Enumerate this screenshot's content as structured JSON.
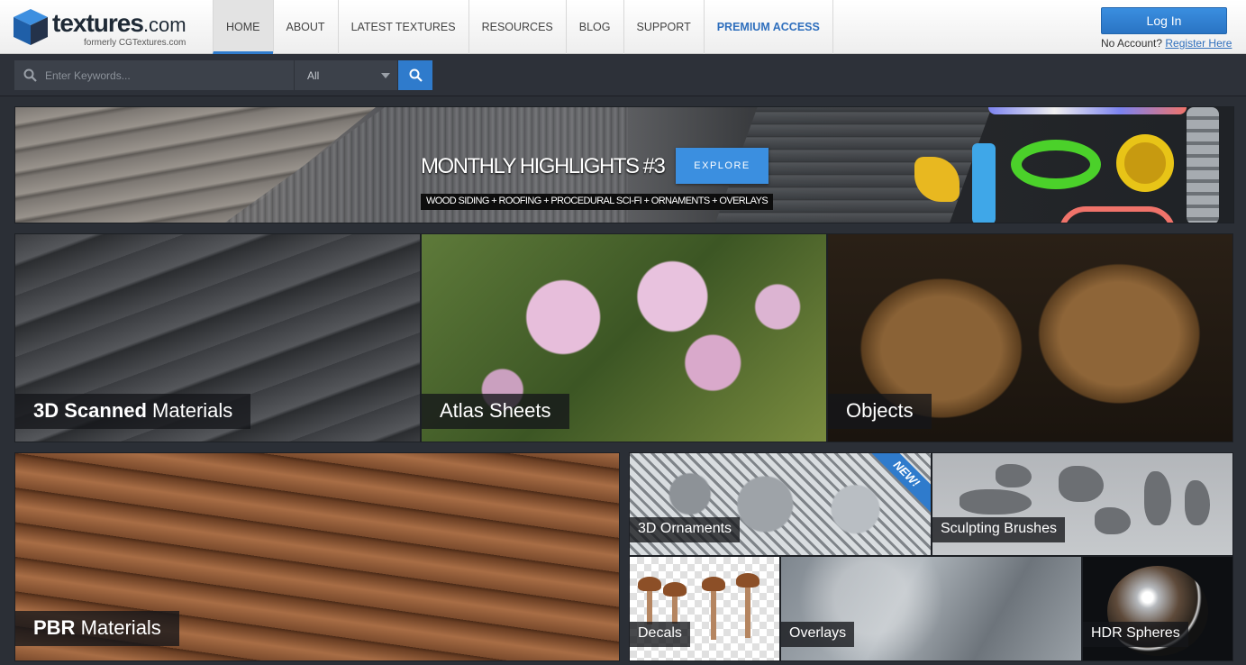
{
  "logo": {
    "name": "textures",
    "tld": ".com",
    "sub": "formerly CGTextures.com"
  },
  "nav": [
    {
      "label": "HOME",
      "active": true
    },
    {
      "label": "ABOUT"
    },
    {
      "label": "LATEST TEXTURES"
    },
    {
      "label": "RESOURCES"
    },
    {
      "label": "BLOG"
    },
    {
      "label": "SUPPORT"
    },
    {
      "label": "PREMIUM ACCESS"
    }
  ],
  "account": {
    "login_label": "Log In",
    "no_account_text": "No Account?",
    "register_label": "Register Here"
  },
  "search": {
    "placeholder": "Enter Keywords...",
    "category_selected": "All"
  },
  "banner": {
    "title": "MONTHLY HIGHLIGHTS #3",
    "subtitle": "WOOD SIDING + ROOFING + PROCEDURAL SCI-FI + ORNAMENTS + OVERLAYS",
    "cta_label": "EXPLORE"
  },
  "categories": {
    "scanned": {
      "bold": "3D Scanned",
      "rest": " Materials"
    },
    "atlas": {
      "label": "Atlas Sheets"
    },
    "objects": {
      "label": "Objects"
    },
    "pbr": {
      "bold": "PBR",
      "rest": " Materials"
    },
    "ornaments": {
      "label": "3D Ornaments",
      "badge": "NEW!"
    },
    "sculpt": {
      "label": "Sculpting Brushes"
    },
    "decals": {
      "label": "Decals"
    },
    "overlays": {
      "label": "Overlays"
    },
    "hdr": {
      "label": "HDR Spheres"
    }
  },
  "colors": {
    "accent": "#2f7bcc",
    "premium": "#2f6fbd",
    "page_bg": "#2b2f36"
  },
  "icons": {
    "search": "magnifier-icon",
    "select": "caret-down-icon",
    "logo": "cube-icon"
  }
}
